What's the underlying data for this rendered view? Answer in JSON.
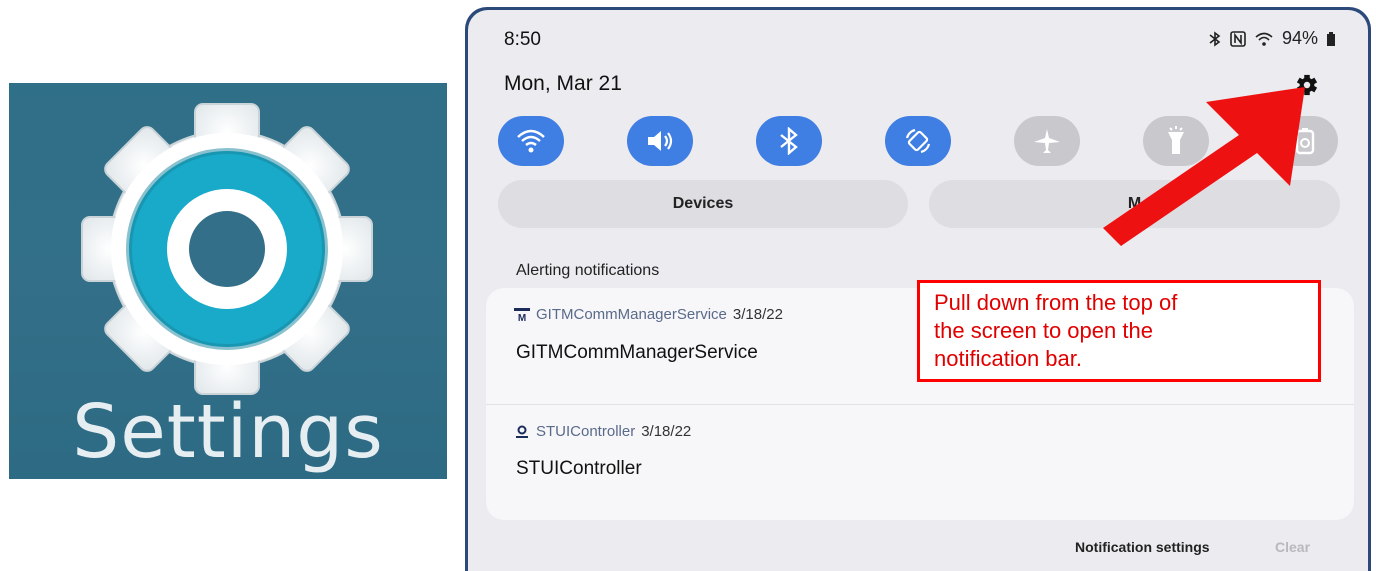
{
  "app_icon": {
    "label": "Settings",
    "icon": "gear-icon"
  },
  "status_bar": {
    "time": "8:50",
    "battery": "94%",
    "icons": [
      "bluetooth-icon",
      "nfc-icon",
      "wifi-icon",
      "battery-icon"
    ]
  },
  "header": {
    "date": "Mon, Mar 21",
    "settings_icon": "gear-icon"
  },
  "quick_settings": [
    {
      "name": "wifi",
      "state": "on"
    },
    {
      "name": "sound",
      "state": "on"
    },
    {
      "name": "bluetooth",
      "state": "on"
    },
    {
      "name": "auto-rotate",
      "state": "on"
    },
    {
      "name": "airplane-mode",
      "state": "off"
    },
    {
      "name": "flashlight",
      "state": "off"
    },
    {
      "name": "power-saving",
      "state": "off"
    }
  ],
  "pills": {
    "devices": "Devices",
    "media": "M"
  },
  "notifications": {
    "section_label": "Alerting notifications",
    "items": [
      {
        "app": "GITMCommManagerService",
        "date": "3/18/22",
        "title": "GITMCommManagerService"
      },
      {
        "app": "STUIController",
        "date": "3/18/22",
        "title": "STUIController"
      }
    ]
  },
  "footer": {
    "settings": "Notification settings",
    "clear": "Clear"
  },
  "annotation": {
    "lines": [
      "Pull down from the top of",
      "the screen to open the",
      "notification bar."
    ],
    "color": "#ff0000"
  },
  "colors": {
    "accent": "#3f7ee3",
    "icon_bg": "#336f88",
    "teal": "#1aaac9"
  }
}
